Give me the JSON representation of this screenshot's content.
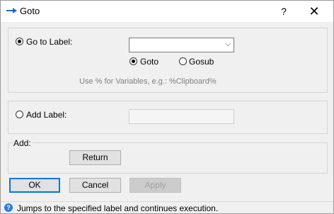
{
  "window": {
    "title": "Goto",
    "help_glyph": "?",
    "close_glyph": "✕"
  },
  "goto_group": {
    "go_to_label_option": "Go to Label:",
    "go_to_label_selected": true,
    "label_combo_value": "",
    "goto_option": "Goto",
    "gosub_option": "Gosub",
    "goto_selected": true,
    "hint": "Use % for Variables, e.g.: %Clipboard%"
  },
  "add_label_group": {
    "add_label_option": "Add Label:",
    "add_label_selected": false,
    "add_label_value": ""
  },
  "add_group": {
    "legend": "Add:",
    "return_button": "Return"
  },
  "footer": {
    "ok": "OK",
    "cancel": "Cancel",
    "apply": "Apply"
  },
  "status": {
    "text": "Jumps to the specified label and continues execution."
  },
  "colors": {
    "accent": "#0078d7",
    "info": "#2a7de1"
  },
  "icons": {
    "title": "arrow-right-icon",
    "combo": "chevron-down-icon",
    "status": "info-icon"
  }
}
